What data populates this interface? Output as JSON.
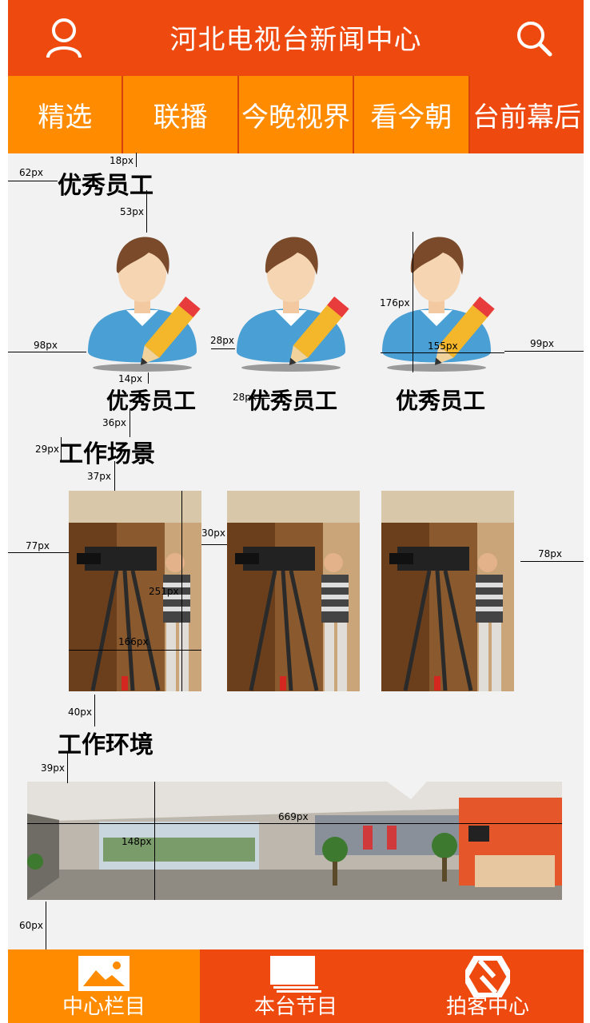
{
  "header": {
    "title": "河北电视台新闻中心",
    "user_icon": "user-icon",
    "search_icon": "search-icon"
  },
  "tabs": [
    {
      "label": "精选",
      "active": false
    },
    {
      "label": "联播",
      "active": false
    },
    {
      "label": "今晚视界",
      "active": false
    },
    {
      "label": "看今朝",
      "active": false
    },
    {
      "label": "台前幕后",
      "active": true
    }
  ],
  "sections": {
    "employees": "优秀员工",
    "scenes": "工作场景",
    "environment": "工作环境"
  },
  "employee_labels": [
    "优秀员工",
    "优秀员工",
    "优秀员工"
  ],
  "dims": {
    "d18": "18px",
    "d62": "62px",
    "d53": "53px",
    "d98": "98px",
    "d28a": "28px",
    "d176": "176px",
    "d155": "155px",
    "d99": "99px",
    "d14": "14px",
    "d28b": "28px",
    "d36": "36px",
    "d29": "29px",
    "d37": "37px",
    "d77": "77px",
    "d30": "30px",
    "d251": "251px",
    "d166": "166px",
    "d78": "78px",
    "d40": "40px",
    "d39": "39px",
    "d669": "669px",
    "d148": "148px",
    "d60": "60px"
  },
  "bottom_nav": [
    {
      "label": "中心栏目",
      "icon": "image-icon",
      "active": true
    },
    {
      "label": "本台节目",
      "icon": "folders-icon",
      "active": false
    },
    {
      "label": "拍客中心",
      "icon": "shutter-icon",
      "active": false
    }
  ],
  "colors": {
    "brand": "#ee4a0f",
    "tab": "#ff8c00",
    "background": "#f2f2f2"
  }
}
